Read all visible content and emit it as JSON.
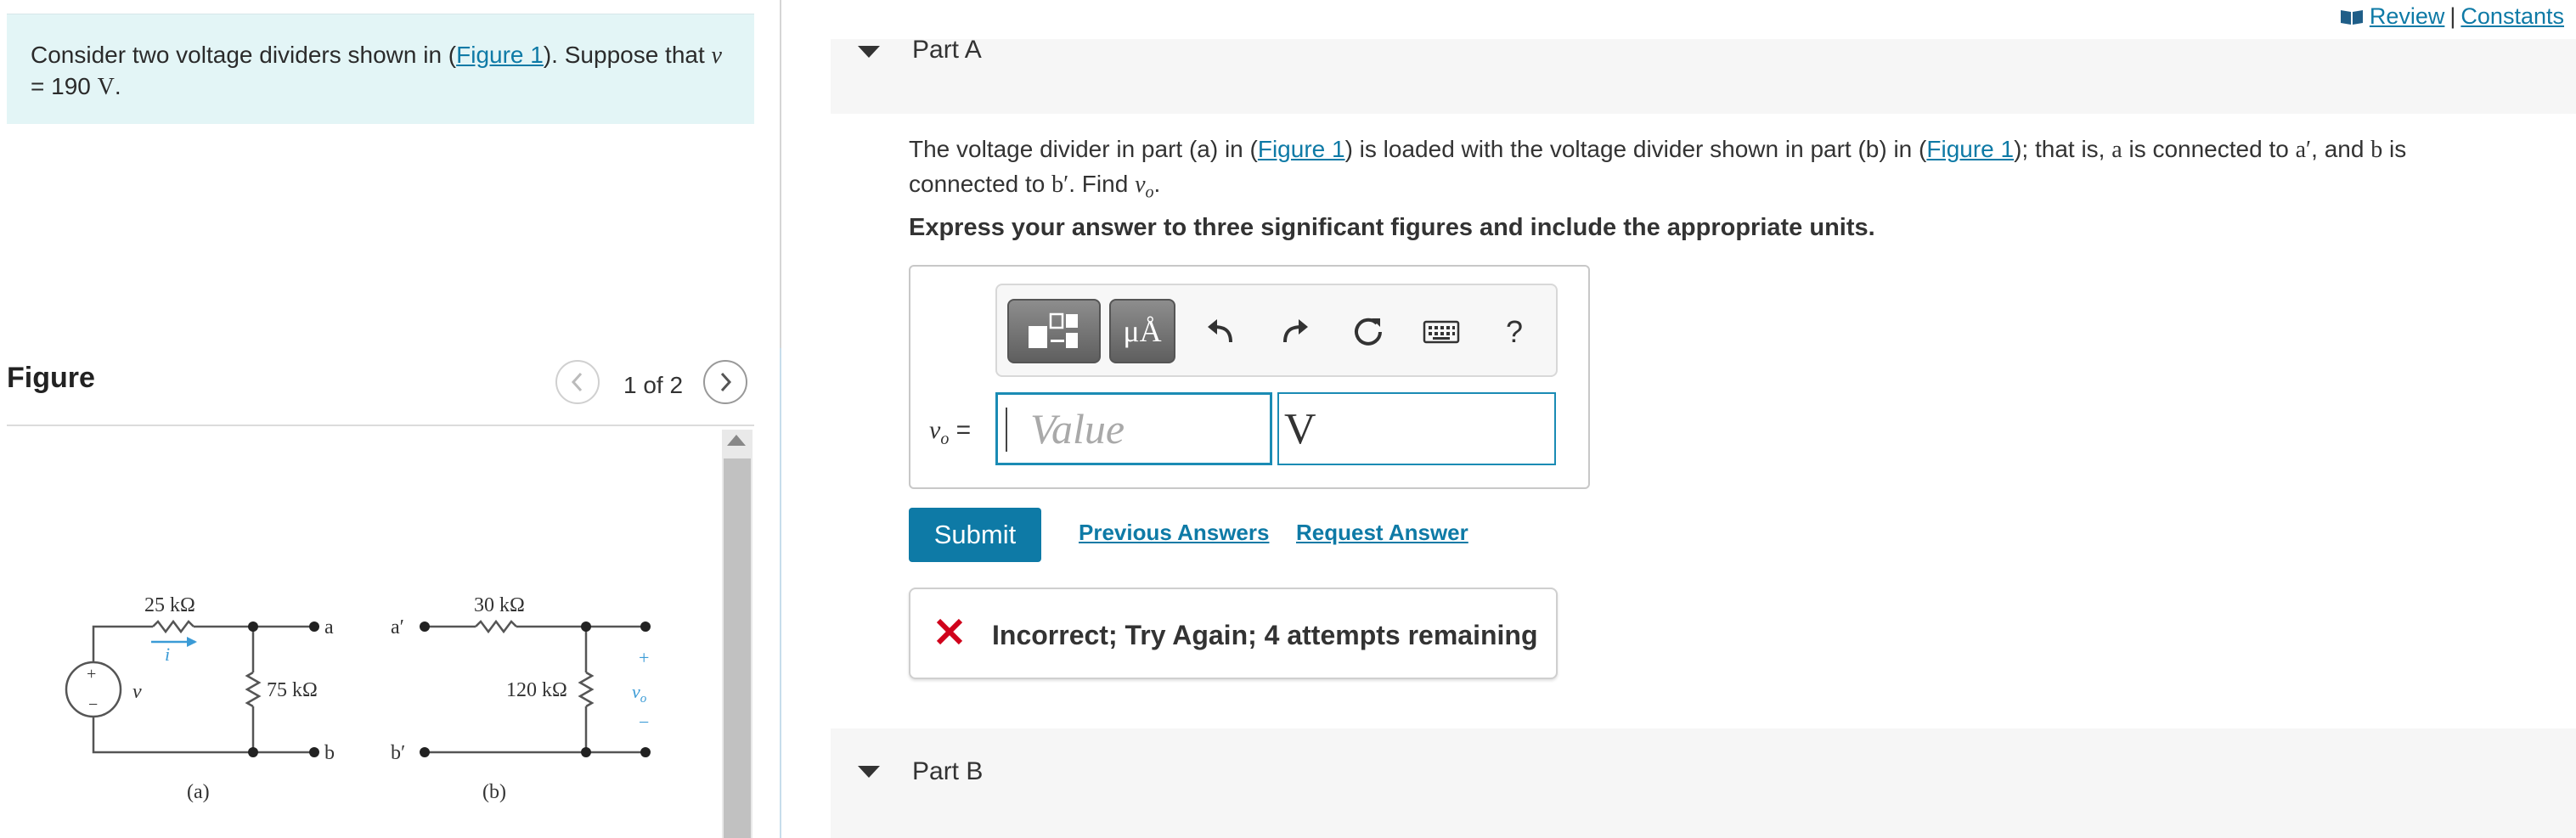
{
  "intro": {
    "before": "Consider two voltage dividers shown in (",
    "figure_link": "Figure 1",
    "mid": "). Suppose that ",
    "var": "v",
    "eq": " = 190 ",
    "unit": "V",
    "end": "."
  },
  "figure": {
    "title": "Figure",
    "page_count": "1 of 2",
    "labels": {
      "r1": "25 kΩ",
      "r2": "75 kΩ",
      "r3": "30 kΩ",
      "r4": "120 kΩ",
      "v": "v",
      "i": "i",
      "vo": "v",
      "vo_sub": "o",
      "a": "a",
      "b": "b",
      "a_prime": "a′",
      "b_prime": "b′",
      "plus": "+",
      "minus": "−",
      "src_plus": "+",
      "src_minus": "−",
      "cap_a": "(a)",
      "cap_b": "(b)"
    }
  },
  "top_links": {
    "review": "Review",
    "separator": "|",
    "constants": "Constants"
  },
  "part_a": {
    "title": "Part A",
    "q1": "The voltage divider in part (a) in (",
    "link1": "Figure 1",
    "q2": ") is loaded with the voltage divider shown in part (b) in (",
    "link2": "Figure 1",
    "q3": "); that is, ",
    "a": "a",
    "q4": " is connected to ",
    "a_prime": "a′",
    "q5": ", and ",
    "b": "b",
    "q6": " is connected to ",
    "b_prime": "b′",
    "q7": ". Find ",
    "vo_var": "v",
    "vo_sub": "o",
    "q8": ".",
    "instruction": "Express your answer to three significant figures and include the appropriate units.",
    "answer": {
      "var_label": "v",
      "var_sub": "o",
      "equals": " =",
      "value_placeholder": "Value",
      "value": "",
      "unit_value": "V"
    },
    "toolbar": {
      "units_label": "μÅ",
      "help_label": "?"
    },
    "submit_label": "Submit",
    "previous_answers": "Previous Answers",
    "request_answer": "Request Answer",
    "feedback": "Incorrect; Try Again; 4 attempts remaining"
  },
  "part_b": {
    "title": "Part B"
  },
  "colors": {
    "accent": "#0e7aa6",
    "intro_bg": "#e3f5f6",
    "error": "#d0021b"
  },
  "icons": [
    "book-icon",
    "chevron-left-icon",
    "chevron-right-icon",
    "caret-down-icon",
    "templates-icon",
    "undo-icon",
    "redo-icon",
    "reset-icon",
    "keyboard-icon",
    "help-icon",
    "x-mark-icon"
  ]
}
